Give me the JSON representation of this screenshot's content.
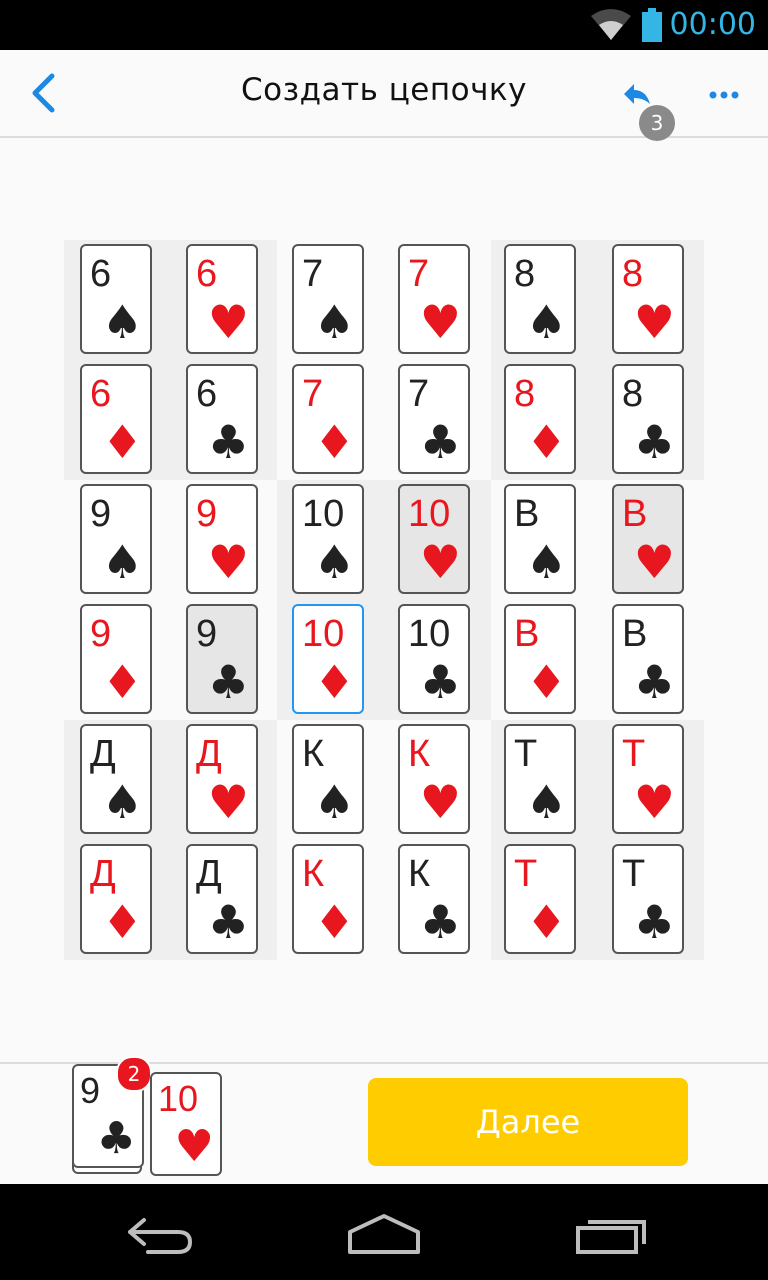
{
  "status_bar": {
    "time": "00:00"
  },
  "header": {
    "title": "Создать цепочку",
    "undo_count": "3"
  },
  "board": {
    "cards": [
      {
        "rank": "6",
        "suit": "♠",
        "color": "black",
        "state": "normal",
        "name": "card-6-spades"
      },
      {
        "rank": "6",
        "suit": "♥",
        "color": "red",
        "state": "normal",
        "name": "card-6-hearts"
      },
      {
        "rank": "7",
        "suit": "♠",
        "color": "black",
        "state": "normal",
        "name": "card-7-spades"
      },
      {
        "rank": "7",
        "suit": "♥",
        "color": "red",
        "state": "normal",
        "name": "card-7-hearts"
      },
      {
        "rank": "8",
        "suit": "♠",
        "color": "black",
        "state": "normal",
        "name": "card-8-spades"
      },
      {
        "rank": "8",
        "suit": "♥",
        "color": "red",
        "state": "normal",
        "name": "card-8-hearts"
      },
      {
        "rank": "6",
        "suit": "♦",
        "color": "red",
        "state": "normal",
        "name": "card-6-diamonds"
      },
      {
        "rank": "6",
        "suit": "♣",
        "color": "black",
        "state": "normal",
        "name": "card-6-clubs"
      },
      {
        "rank": "7",
        "suit": "♦",
        "color": "red",
        "state": "normal",
        "name": "card-7-diamonds"
      },
      {
        "rank": "7",
        "suit": "♣",
        "color": "black",
        "state": "normal",
        "name": "card-7-clubs"
      },
      {
        "rank": "8",
        "suit": "♦",
        "color": "red",
        "state": "normal",
        "name": "card-8-diamonds"
      },
      {
        "rank": "8",
        "suit": "♣",
        "color": "black",
        "state": "normal",
        "name": "card-8-clubs"
      },
      {
        "rank": "9",
        "suit": "♠",
        "color": "black",
        "state": "normal",
        "name": "card-9-spades"
      },
      {
        "rank": "9",
        "suit": "♥",
        "color": "red",
        "state": "normal",
        "name": "card-9-hearts"
      },
      {
        "rank": "10",
        "suit": "♠",
        "color": "black",
        "state": "normal",
        "name": "card-10-spades"
      },
      {
        "rank": "10",
        "suit": "♥",
        "color": "red",
        "state": "dim",
        "name": "card-10-hearts"
      },
      {
        "rank": "В",
        "suit": "♠",
        "color": "black",
        "state": "normal",
        "name": "card-jack-spades"
      },
      {
        "rank": "В",
        "suit": "♥",
        "color": "red",
        "state": "dim",
        "name": "card-jack-hearts"
      },
      {
        "rank": "9",
        "suit": "♦",
        "color": "red",
        "state": "normal",
        "name": "card-9-diamonds"
      },
      {
        "rank": "9",
        "suit": "♣",
        "color": "black",
        "state": "dim",
        "name": "card-9-clubs"
      },
      {
        "rank": "10",
        "suit": "♦",
        "color": "red",
        "state": "selected",
        "name": "card-10-diamonds"
      },
      {
        "rank": "10",
        "suit": "♣",
        "color": "black",
        "state": "normal",
        "name": "card-10-clubs"
      },
      {
        "rank": "В",
        "suit": "♦",
        "color": "red",
        "state": "normal",
        "name": "card-jack-diamonds"
      },
      {
        "rank": "В",
        "suit": "♣",
        "color": "black",
        "state": "normal",
        "name": "card-jack-clubs"
      },
      {
        "rank": "Д",
        "suit": "♠",
        "color": "black",
        "state": "normal",
        "name": "card-queen-spades"
      },
      {
        "rank": "Д",
        "suit": "♥",
        "color": "red",
        "state": "normal",
        "name": "card-queen-hearts"
      },
      {
        "rank": "К",
        "suit": "♠",
        "color": "black",
        "state": "normal",
        "name": "card-king-spades"
      },
      {
        "rank": "К",
        "suit": "♥",
        "color": "red",
        "state": "normal",
        "name": "card-king-hearts"
      },
      {
        "rank": "Т",
        "suit": "♠",
        "color": "black",
        "state": "normal",
        "name": "card-ace-spades"
      },
      {
        "rank": "Т",
        "suit": "♥",
        "color": "red",
        "state": "normal",
        "name": "card-ace-hearts"
      },
      {
        "rank": "Д",
        "suit": "♦",
        "color": "red",
        "state": "normal",
        "name": "card-queen-diamonds"
      },
      {
        "rank": "Д",
        "suit": "♣",
        "color": "black",
        "state": "normal",
        "name": "card-queen-clubs"
      },
      {
        "rank": "К",
        "suit": "♦",
        "color": "red",
        "state": "normal",
        "name": "card-king-diamonds"
      },
      {
        "rank": "К",
        "suit": "♣",
        "color": "black",
        "state": "normal",
        "name": "card-king-clubs"
      },
      {
        "rank": "Т",
        "suit": "♦",
        "color": "red",
        "state": "normal",
        "name": "card-ace-diamonds"
      },
      {
        "rank": "Т",
        "suit": "♣",
        "color": "black",
        "state": "normal",
        "name": "card-ace-clubs"
      }
    ]
  },
  "hand": {
    "cards": [
      {
        "rank": "9",
        "suit": "♣",
        "color": "black"
      },
      {
        "rank": "10",
        "suit": "♥",
        "color": "red"
      }
    ],
    "stack_count": "2"
  },
  "next_button": {
    "label": "Далее"
  },
  "colors": {
    "red": "#e8161e",
    "black": "#222222",
    "accent": "#2196f3",
    "button": "#ffcc00"
  }
}
